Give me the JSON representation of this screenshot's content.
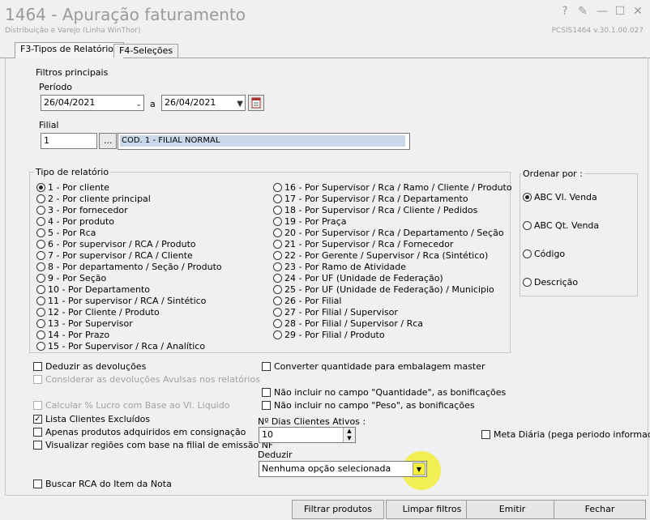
{
  "window": {
    "title": "1464 - Apuração faturamento",
    "subtitle": "Distribuição e Varejo (Linha WinThor)",
    "program": "PCSIS1464  v.30.1.00.027",
    "btn_help": "?",
    "btn_edit": "✎",
    "btn_min": "—",
    "btn_max": "☐",
    "btn_close": "✕"
  },
  "tabs": [
    {
      "label": "F3-Tipos de Relatórios"
    },
    {
      "label": "F4-Seleções"
    }
  ],
  "filtros": {
    "legend": "Filtros principais",
    "periodo_label": "Período",
    "date_from": "26/04/2021",
    "separator": "a",
    "date_to": "26/04/2021",
    "filial_label": "Filial",
    "filial_code": "1",
    "browse": "...",
    "filial_desc": "COD. 1 - FILIAL NORMAL"
  },
  "tipo": {
    "legend": "Tipo de relatório",
    "col1": [
      "1 - Por cliente",
      "2 - Por cliente principal",
      "3 - Por fornecedor",
      "4 - Por produto",
      "5 - Por Rca",
      "6 - Por supervisor / RCA / Produto",
      "7 - Por supervisor / RCA / Cliente",
      "8 - Por departamento / Seção / Produto",
      "9 - Por Seção",
      "10 - Por Departamento",
      "11 - Por supervisor / RCA / Sintético",
      "12 - Por Cliente / Produto",
      "13 - Por Supervisor",
      "14 - Por Prazo",
      "15 - Por Supervisor / Rca / Analítico"
    ],
    "col2": [
      "16 - Por Supervisor / Rca / Ramo /  Cliente / Produto",
      "17 - Por Supervisor / Rca / Departamento",
      "18 - Por Supervisor / Rca / Cliente / Pedidos",
      "19 - Por Praça",
      "20 - Por Supervisor / Rca / Departamento / Seção",
      "21 - Por Supervisor / Rca / Fornecedor",
      "22 - Por Gerente / Supervisor / Rca (Sintético)",
      "23 - Por Ramo de Atividade",
      "24 - Por UF (Unidade de Federação)",
      "25 - Por UF (Unidade de Federação) / Municipio",
      "26 - Por Filial",
      "27 - Por Filial / Supervisor",
      "28 - Por Filial / Supervisor / Rca",
      "29 - Por Filial / Produto"
    ],
    "selected": "1 - Por cliente"
  },
  "ordenar": {
    "legend": "Ordenar por :",
    "options": [
      "ABC Vl. Venda",
      "ABC Qt. Venda",
      "Código",
      "Descrição"
    ],
    "selected": "ABC Vl. Venda"
  },
  "options": {
    "deduzir_devolucoes": "Deduzir as devoluções",
    "considerar_avulsas": "Considerar as devoluções Avulsas nos relatórios",
    "calcular_lucro": "Calcular % Lucro com Base ao Vl. Liquido",
    "lista_excluidos": "Lista Clientes Excluídos",
    "apenas_consignacao": "Apenas produtos adquiridos em consignação",
    "visualizar_regioes": "Visualizar regiões com base na filial de emissão NF",
    "buscar_rca": "Buscar RCA do Item da Nota",
    "converter_qtd": "Converter quantidade para embalagem master",
    "nao_incluir_qtd": "Não incluir no campo \"Quantidade\", as bonificações",
    "nao_incluir_peso": "Não incluir no campo \"Peso\", as bonificações",
    "meta_diaria": "Meta Diária (pega periodo informado)"
  },
  "dias": {
    "label": "Nº Dias Clientes Ativos :",
    "value": "10"
  },
  "deduzir": {
    "label": "Deduzir",
    "value": "Nenhuma opção selecionada"
  },
  "buttons": {
    "filtrar": "Filtrar produtos",
    "limpar": "Limpar filtros",
    "emitir": "Emitir",
    "fechar": "Fechar"
  },
  "colors": {
    "highlight": "#f2ee3a",
    "selection": "#c8d8e8"
  }
}
